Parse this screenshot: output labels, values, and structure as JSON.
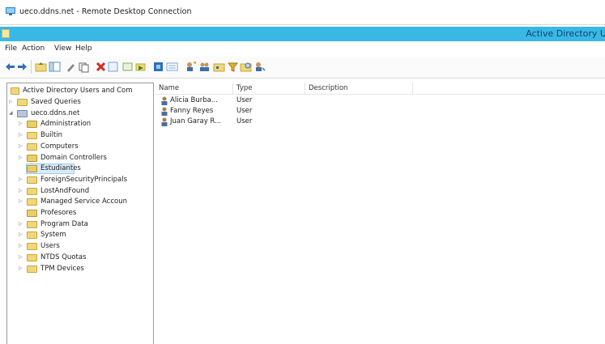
{
  "rdp": {
    "title": "ueco.ddns.net - Remote Desktop Connection"
  },
  "mmc": {
    "title": "Active Directory U"
  },
  "menu": [
    "File",
    "Action",
    "View",
    "Help"
  ],
  "toolbar": {
    "icons": [
      "back-icon",
      "forward-icon",
      "up-folder-icon",
      "console-tree-icon",
      "properties-icon",
      "copy-icon",
      "delete-icon",
      "refresh-icon",
      "export-icon",
      "move-icon",
      "help-icon",
      "view-icon",
      "add-user-icon",
      "add-group-icon",
      "add-ou-icon",
      "filter-icon",
      "find-icon",
      "add-to-group-icon"
    ]
  },
  "tree": {
    "root": "Active Directory Users and Com",
    "items": [
      {
        "label": "Saved Queries",
        "level": 1,
        "expander": "▷",
        "folder": "yellow"
      },
      {
        "label": "ueco.ddns.net",
        "level": 1,
        "expander": "◢",
        "folder": "domain"
      },
      {
        "label": "Administration",
        "level": 2,
        "expander": "▷",
        "folder": "ou"
      },
      {
        "label": "Builtin",
        "level": 2,
        "expander": "▷",
        "folder": "yellow"
      },
      {
        "label": "Computers",
        "level": 2,
        "expander": "▷",
        "folder": "yellow"
      },
      {
        "label": "Domain Controllers",
        "level": 2,
        "expander": "▷",
        "folder": "ou"
      },
      {
        "label": "Estudiantes",
        "level": 2,
        "expander": "",
        "folder": "ou",
        "selected": true
      },
      {
        "label": "ForeignSecurityPrincipals",
        "level": 2,
        "expander": "▷",
        "folder": "yellow"
      },
      {
        "label": "LostAndFound",
        "level": 2,
        "expander": "▷",
        "folder": "yellow"
      },
      {
        "label": "Managed Service Accoun",
        "level": 2,
        "expander": "▷",
        "folder": "yellow"
      },
      {
        "label": "Profesores",
        "level": 2,
        "expander": "",
        "folder": "ou"
      },
      {
        "label": "Program Data",
        "level": 2,
        "expander": "▷",
        "folder": "yellow"
      },
      {
        "label": "System",
        "level": 2,
        "expander": "▷",
        "folder": "yellow"
      },
      {
        "label": "Users",
        "level": 2,
        "expander": "▷",
        "folder": "yellow"
      },
      {
        "label": "NTDS Quotas",
        "level": 2,
        "expander": "▷",
        "folder": "yellow"
      },
      {
        "label": "TPM Devices",
        "level": 2,
        "expander": "▷",
        "folder": "yellow"
      }
    ]
  },
  "list": {
    "columns": [
      "Name",
      "Type",
      "Description"
    ],
    "rows": [
      {
        "name": "Alicia Burba...",
        "type": "User",
        "description": ""
      },
      {
        "name": "Fanny Reyes",
        "type": "User",
        "description": ""
      },
      {
        "name": "Juan Garay R...",
        "type": "User",
        "description": ""
      }
    ]
  },
  "colors": {
    "mmc_title": "#39b8e6",
    "selection": "#d9ebf9"
  }
}
